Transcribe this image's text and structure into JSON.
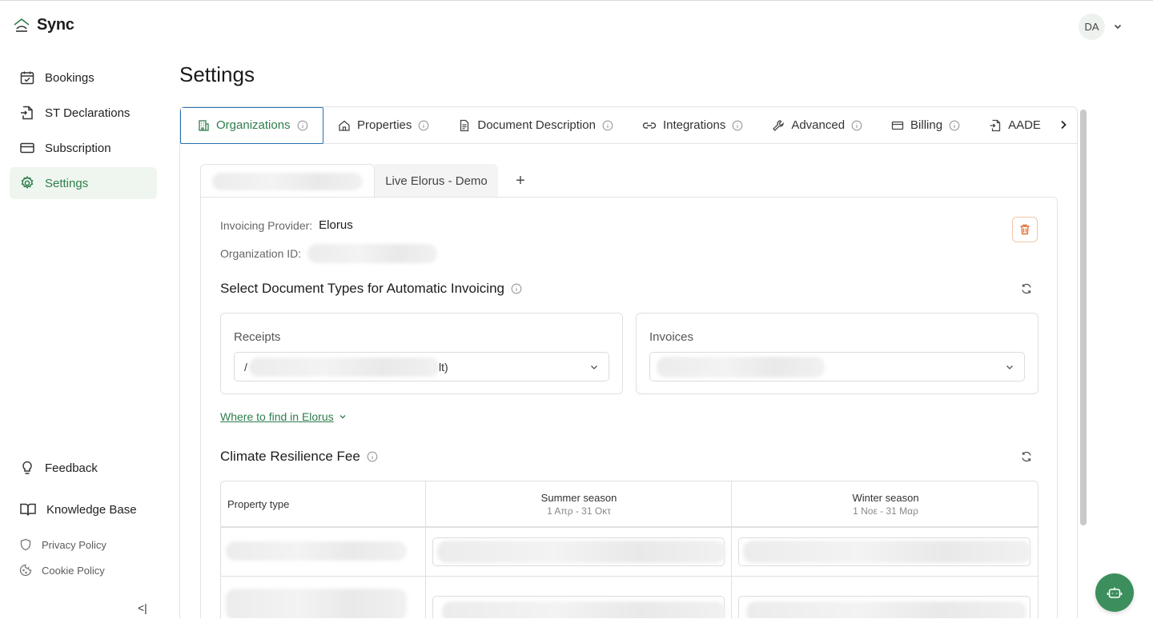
{
  "app": {
    "name": "Sync"
  },
  "user": {
    "initials": "DA"
  },
  "sidebar": {
    "items": [
      {
        "label": "Bookings",
        "icon": "calendar-check-icon"
      },
      {
        "label": "ST Declarations",
        "icon": "document-arrow-icon"
      },
      {
        "label": "Subscription",
        "icon": "credit-card-icon"
      },
      {
        "label": "Settings",
        "icon": "gear-icon",
        "active": true
      }
    ],
    "bottom": [
      {
        "label": "Feedback",
        "icon": "lightbulb-icon"
      },
      {
        "label": "Knowledge Base",
        "icon": "book-icon"
      }
    ],
    "legal": [
      {
        "label": "Privacy Policy",
        "icon": "shield-icon"
      },
      {
        "label": "Cookie Policy",
        "icon": "cookie-icon"
      }
    ],
    "collapse_label": "<|"
  },
  "page": {
    "title": "Settings"
  },
  "tabs": [
    {
      "label": "Organizations",
      "icon": "building-icon",
      "active": true
    },
    {
      "label": "Properties",
      "icon": "house-icon"
    },
    {
      "label": "Document Description",
      "icon": "file-text-icon"
    },
    {
      "label": "Integrations",
      "icon": "link-icon"
    },
    {
      "label": "Advanced",
      "icon": "wrench-icon"
    },
    {
      "label": "Billing",
      "icon": "credit-card-icon"
    },
    {
      "label": "AADE",
      "icon": "document-arrow-icon"
    }
  ],
  "org_tabs": {
    "second": "Live Elorus - Demo",
    "add": "+"
  },
  "org": {
    "provider_label": "Invoicing Provider:",
    "provider_value": "Elorus",
    "id_label": "Organization ID:"
  },
  "doc_types": {
    "title": "Select Document Types for Automatic Invoicing",
    "receipts_label": "Receipts",
    "receipts_value_prefix": "/",
    "receipts_value_suffix": "lt)",
    "invoices_label": "Invoices",
    "find_link": "Where to find in Elorus"
  },
  "climate_fee": {
    "title": "Climate Resilience Fee",
    "col_property": "Property type",
    "col_summer": "Summer season",
    "col_summer_range": "1 Απρ - 31 Οκτ",
    "col_winter": "Winter season",
    "col_winter_range": "1 Νοε - 31 Μαρ"
  },
  "colors": {
    "accent": "#2f7d4c",
    "fab": "#3c8f5c",
    "active_bg": "#eef6ef",
    "focus_border": "#2a6fb0",
    "danger": "#e0733a"
  }
}
